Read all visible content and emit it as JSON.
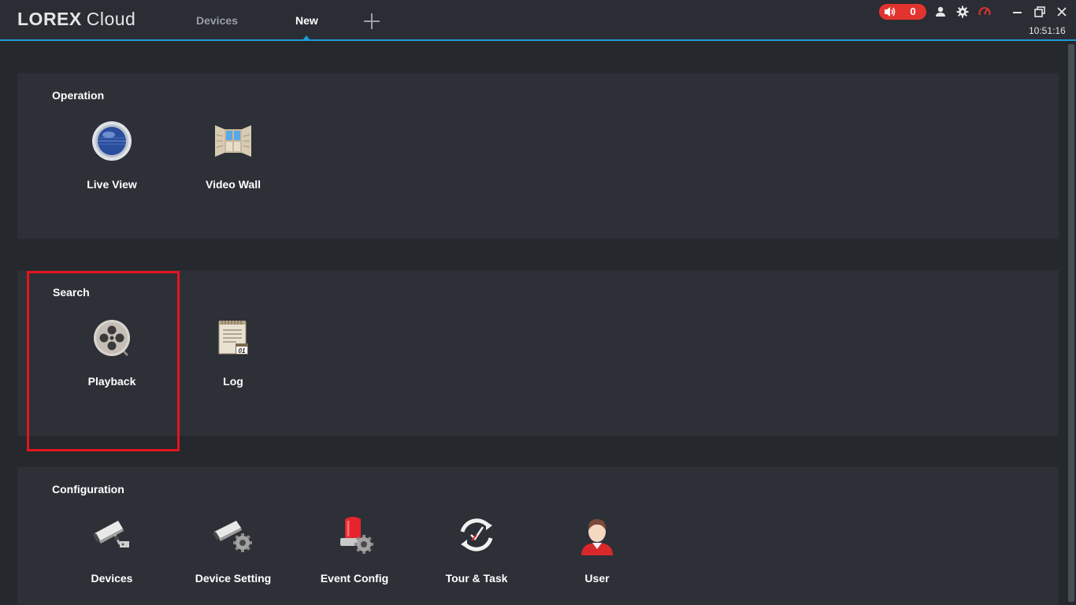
{
  "header": {
    "brand": "LOREX",
    "product": "Cloud",
    "tabs": [
      {
        "label": "Devices",
        "active": false
      },
      {
        "label": "New",
        "active": true
      }
    ],
    "add_tab_icon": "plus-icon",
    "alarm_count": "0",
    "clock": "10:51:16",
    "accent_color": "#1d9bd8",
    "alarm_color": "#e2342f"
  },
  "sections": {
    "operation": {
      "title": "Operation",
      "items": [
        {
          "label": "Live View",
          "icon": "live-view-icon"
        },
        {
          "label": "Video Wall",
          "icon": "video-wall-icon"
        }
      ]
    },
    "search": {
      "title": "Search",
      "items": [
        {
          "label": "Playback",
          "icon": "playback-reel-icon"
        },
        {
          "label": "Log",
          "icon": "log-notepad-icon"
        }
      ]
    },
    "configuration": {
      "title": "Configuration",
      "items": [
        {
          "label": "Devices",
          "icon": "camera-icon"
        },
        {
          "label": "Device Setting",
          "icon": "camera-gear-icon"
        },
        {
          "label": "Event Config",
          "icon": "alarm-light-gear-icon"
        },
        {
          "label": "Tour & Task",
          "icon": "tour-clock-icon"
        },
        {
          "label": "User",
          "icon": "user-avatar-icon"
        }
      ]
    }
  },
  "log_icon_badge": "01",
  "highlight_color": "#e3151e"
}
